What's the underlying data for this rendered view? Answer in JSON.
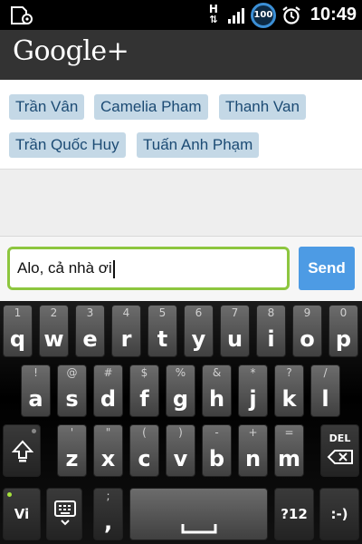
{
  "status_bar": {
    "network_label": "H",
    "battery_level": "100",
    "time": "10:49",
    "icons": [
      "sd-settings-icon",
      "data-arrows-icon",
      "signal-icon",
      "battery-icon",
      "alarm-clock-icon"
    ]
  },
  "app": {
    "title": "Google+"
  },
  "recipients": [
    "Trần Vân",
    "Camelia Pham",
    "Thanh Van",
    "Trần Quốc Huy",
    "Tuấn Anh Phạm"
  ],
  "compose": {
    "message": "Alo, cả nhà ơi",
    "send_label": "Send"
  },
  "keyboard": {
    "row1": [
      {
        "main": "q",
        "hint": "1"
      },
      {
        "main": "w",
        "hint": "2"
      },
      {
        "main": "e",
        "hint": "3"
      },
      {
        "main": "r",
        "hint": "4"
      },
      {
        "main": "t",
        "hint": "5"
      },
      {
        "main": "y",
        "hint": "6"
      },
      {
        "main": "u",
        "hint": "7"
      },
      {
        "main": "i",
        "hint": "8"
      },
      {
        "main": "o",
        "hint": "9"
      },
      {
        "main": "p",
        "hint": "0"
      }
    ],
    "row2": [
      {
        "main": "a",
        "hint": "!"
      },
      {
        "main": "s",
        "hint": "@"
      },
      {
        "main": "d",
        "hint": "#"
      },
      {
        "main": "f",
        "hint": "$"
      },
      {
        "main": "g",
        "hint": "%"
      },
      {
        "main": "h",
        "hint": "&"
      },
      {
        "main": "j",
        "hint": "*"
      },
      {
        "main": "k",
        "hint": "?"
      },
      {
        "main": "l",
        "hint": "/"
      }
    ],
    "row3": [
      {
        "main": "z",
        "hint": "'"
      },
      {
        "main": "x",
        "hint": "\""
      },
      {
        "main": "c",
        "hint": "("
      },
      {
        "main": "v",
        "hint": ")"
      },
      {
        "main": "b",
        "hint": "-"
      },
      {
        "main": "n",
        "hint": "+"
      },
      {
        "main": "m",
        "hint": "="
      }
    ],
    "shift_icon": "shift-arrow-icon",
    "del_label": "DEL",
    "lang_label": "Vi",
    "settings_icon": "keyboard-settings-icon",
    "comma_hint": ";",
    "comma_label": ",",
    "period_hint": "'",
    "period_label": ".",
    "symbols_label": "?12",
    "smiley_label": ":-)"
  }
}
